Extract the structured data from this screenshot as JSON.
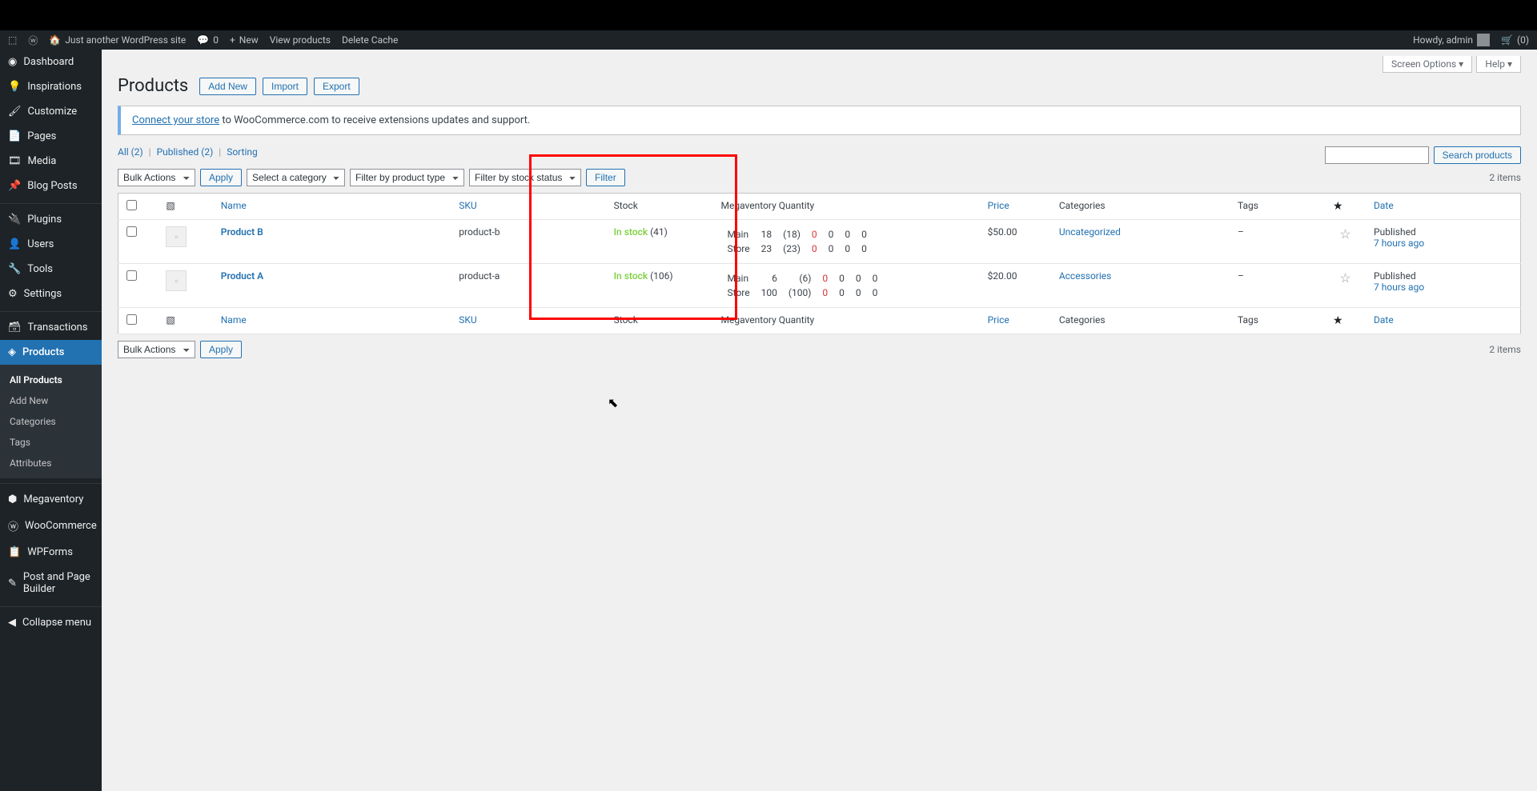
{
  "adminbar": {
    "site_name": "Just another WordPress site",
    "comments": "0",
    "new": "New",
    "view_products": "View products",
    "delete_cache": "Delete Cache",
    "howdy": "Howdy, admin",
    "cart": "(0)"
  },
  "sidebar": {
    "items": [
      {
        "label": "Dashboard",
        "icon": "dashboard"
      },
      {
        "label": "Inspirations",
        "icon": "bulb"
      },
      {
        "label": "Customize",
        "icon": "brush"
      },
      {
        "label": "Pages",
        "icon": "page"
      },
      {
        "label": "Media",
        "icon": "media"
      },
      {
        "label": "Blog Posts",
        "icon": "pin"
      },
      {
        "label": "Plugins",
        "icon": "plug"
      },
      {
        "label": "Users",
        "icon": "user"
      },
      {
        "label": "Tools",
        "icon": "wrench"
      },
      {
        "label": "Settings",
        "icon": "gear"
      },
      {
        "label": "Transactions",
        "icon": "db"
      },
      {
        "label": "Products",
        "icon": "box",
        "current": true
      },
      {
        "label": "Megaventory",
        "icon": "cube"
      },
      {
        "label": "WooCommerce",
        "icon": "woo"
      },
      {
        "label": "WPForms",
        "icon": "form"
      },
      {
        "label": "Post and Page Builder",
        "icon": "pencil"
      },
      {
        "label": "Collapse menu",
        "icon": "collapse"
      }
    ],
    "submenu": [
      {
        "label": "All Products",
        "active": true
      },
      {
        "label": "Add New"
      },
      {
        "label": "Categories"
      },
      {
        "label": "Tags"
      },
      {
        "label": "Attributes"
      }
    ]
  },
  "screen_options": "Screen Options ▾",
  "help": "Help ▾",
  "page": {
    "title": "Products",
    "add_new": "Add New",
    "import": "Import",
    "export": "Export"
  },
  "notice": {
    "link": "Connect your store",
    "rest": " to WooCommerce.com to receive extensions updates and support."
  },
  "subsub": {
    "all": "All (2)",
    "published": "Published (2)",
    "sorting": "Sorting"
  },
  "search": {
    "button": "Search products"
  },
  "filters": {
    "bulk": "Bulk Actions",
    "apply": "Apply",
    "category": "Select a category",
    "type": "Filter by product type",
    "stock": "Filter by stock status",
    "filter": "Filter",
    "items": "2 items"
  },
  "columns": {
    "name": "Name",
    "sku": "SKU",
    "stock": "Stock",
    "mv": "Megaventory Quantity",
    "price": "Price",
    "categories": "Categories",
    "tags": "Tags",
    "date": "Date"
  },
  "rows": [
    {
      "name": "Product B",
      "sku": "product-b",
      "stock_label": "In stock",
      "stock_qty": "(41)",
      "mv": [
        {
          "loc": "Main",
          "q": "18",
          "p": "(18)",
          "a": "0",
          "b": "0",
          "c": "0",
          "d": "0"
        },
        {
          "loc": "Store",
          "q": "23",
          "p": "(23)",
          "a": "0",
          "b": "0",
          "c": "0",
          "d": "0"
        }
      ],
      "price": "$50.00",
      "category": "Uncategorized",
      "tags": "–",
      "pub": "Published",
      "date": "7 hours ago"
    },
    {
      "name": "Product A",
      "sku": "product-a",
      "stock_label": "In stock",
      "stock_qty": "(106)",
      "mv": [
        {
          "loc": "Main",
          "q": "6",
          "p": "(6)",
          "a": "0",
          "b": "0",
          "c": "0",
          "d": "0"
        },
        {
          "loc": "Store",
          "q": "100",
          "p": "(100)",
          "a": "0",
          "b": "0",
          "c": "0",
          "d": "0"
        }
      ],
      "price": "$20.00",
      "category": "Accessories",
      "tags": "–",
      "pub": "Published",
      "date": "7 hours ago"
    }
  ]
}
